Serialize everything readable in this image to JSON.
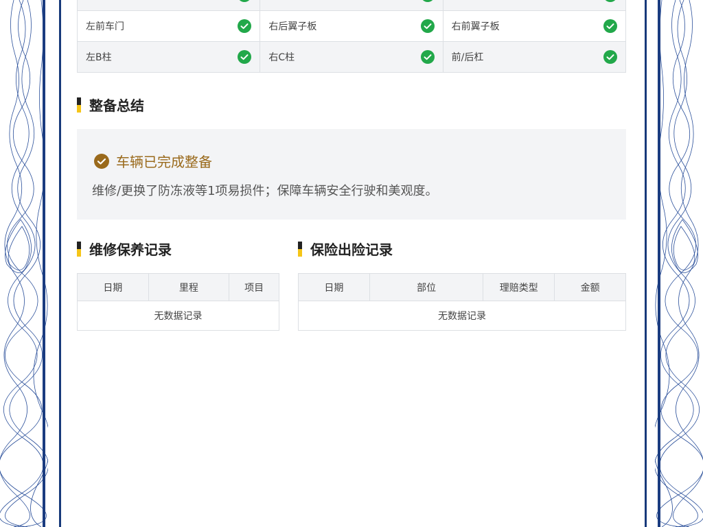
{
  "inspection": {
    "rows": [
      [
        {
          "label": ""
        },
        {
          "label": ""
        },
        {
          "label": ""
        }
      ],
      [
        {
          "label": "左前车门"
        },
        {
          "label": "右后翼子板"
        },
        {
          "label": "右前翼子板"
        }
      ],
      [
        {
          "label": "左B柱"
        },
        {
          "label": "右C柱"
        },
        {
          "label": "前/后杠"
        }
      ]
    ],
    "ok_icon": "check-circle-icon",
    "ok_color": "#22a84a"
  },
  "summary": {
    "title": "整备总结",
    "status": "车辆已完成整备",
    "status_icon": "check-circle-icon",
    "status_color": "#9a6a1c",
    "text": "维修/更换了防冻液等1项易损件；保障车辆安全行驶和美观度。"
  },
  "maintenance": {
    "title": "维修保养记录",
    "columns": [
      "日期",
      "里程",
      "项目"
    ],
    "empty_text": "无数据记录"
  },
  "insurance": {
    "title": "保险出险记录",
    "columns": [
      "日期",
      "部位",
      "理赔类型",
      "金额"
    ],
    "empty_text": "无数据记录"
  },
  "colors": {
    "frame": "#17397a",
    "accent_yellow": "#f5c518",
    "panel_bg": "#f3f4f6"
  }
}
